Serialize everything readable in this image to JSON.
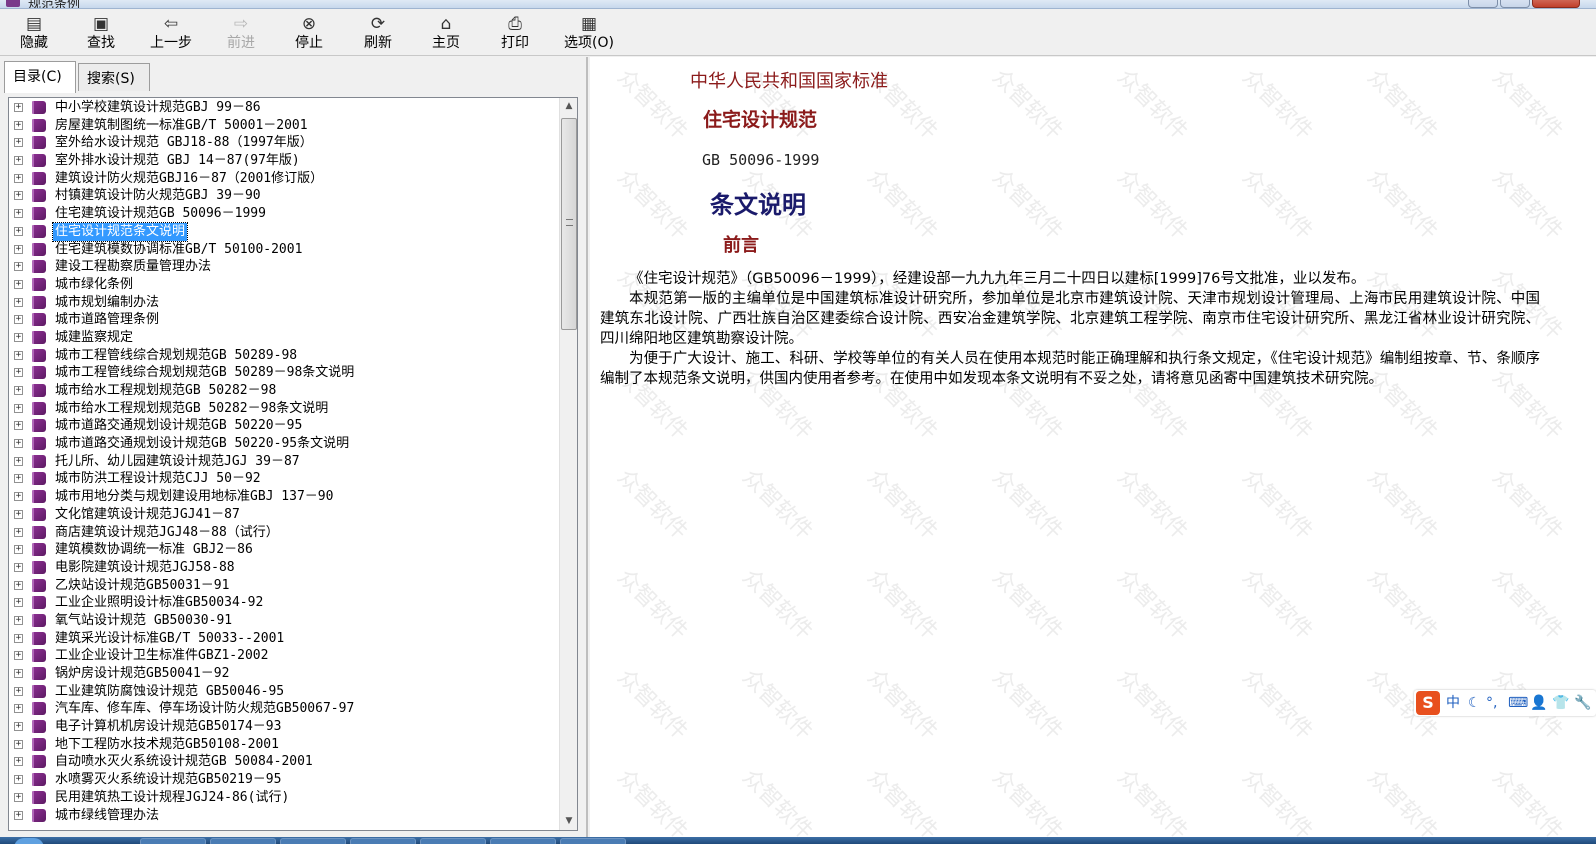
{
  "window": {
    "title": "规范条例"
  },
  "toolbar": {
    "buttons": [
      {
        "label": "隐藏",
        "icon": "hide-icon",
        "enabled": true
      },
      {
        "label": "查找",
        "icon": "find-icon",
        "enabled": true
      },
      {
        "label": "上一步",
        "icon": "back-arrow-icon",
        "enabled": true
      },
      {
        "label": "前进",
        "icon": "forward-arrow-icon",
        "enabled": false
      },
      {
        "label": "停止",
        "icon": "stop-icon",
        "enabled": true
      },
      {
        "label": "刷新",
        "icon": "refresh-icon",
        "enabled": true
      },
      {
        "label": "主页",
        "icon": "home-icon",
        "enabled": true
      },
      {
        "label": "打印",
        "icon": "print-icon",
        "enabled": true
      },
      {
        "label": "选项(O)",
        "icon": "options-icon",
        "enabled": true
      }
    ]
  },
  "sidebar": {
    "tabs": [
      {
        "label": "目录(C)",
        "active": true
      },
      {
        "label": "搜索(S)",
        "active": false
      }
    ],
    "tree": [
      {
        "label": "中小学校建筑设计规范GBJ 99－86"
      },
      {
        "label": "房屋建筑制图统一标准GB/T 50001－2001"
      },
      {
        "label": "室外给水设计规范 GBJ18-88（1997年版）"
      },
      {
        "label": "室外排水设计规范 GBJ 14－87(97年版)"
      },
      {
        "label": "建筑设计防火规范GBJ16－87（2001修订版）"
      },
      {
        "label": "村镇建筑设计防火规范GBJ 39－90"
      },
      {
        "label": "住宅建筑设计规范GB 50096－1999"
      },
      {
        "label": "住宅设计规范条文说明",
        "selected": true
      },
      {
        "label": "住宅建筑模数协调标准GB/T 50100-2001"
      },
      {
        "label": "建设工程勘察质量管理办法"
      },
      {
        "label": "城市绿化条例"
      },
      {
        "label": "城市规划编制办法"
      },
      {
        "label": "城市道路管理条例"
      },
      {
        "label": "城建监察规定"
      },
      {
        "label": "城市工程管线综合规划规范GB 50289-98"
      },
      {
        "label": "城市工程管线综合规划规范GB 50289－98条文说明"
      },
      {
        "label": "城市给水工程规划规范GB 50282－98"
      },
      {
        "label": "城市给水工程规划规范GB 50282－98条文说明"
      },
      {
        "label": "城市道路交通规划设计规范GB 50220－95"
      },
      {
        "label": "城市道路交通规划设计规范GB 50220-95条文说明"
      },
      {
        "label": "托儿所、幼儿园建筑设计规范JGJ 39－87"
      },
      {
        "label": "城市防洪工程设计规范CJJ 50－92"
      },
      {
        "label": "城市用地分类与规划建设用地标准GBJ 137－90"
      },
      {
        "label": "文化馆建筑设计规范JGJ41－87"
      },
      {
        "label": "商店建筑设计规范JGJ48－88（试行）"
      },
      {
        "label": "建筑模数协调统一标准 GBJ2－86"
      },
      {
        "label": "电影院建筑设计规范JGJ58-88"
      },
      {
        "label": "乙炔站设计规范GB50031－91"
      },
      {
        "label": "工业企业照明设计标准GB50034-92"
      },
      {
        "label": "氧气站设计规范 GB50030-91"
      },
      {
        "label": "建筑采光设计标准GB/T 50033--2001"
      },
      {
        "label": "工业企业设计卫生标准件GBZ1-2002"
      },
      {
        "label": "锅炉房设计规范GB50041－92"
      },
      {
        "label": "工业建筑防腐蚀设计规范 GB50046-95"
      },
      {
        "label": "汽车库、修车库、停车场设计防火规范GB50067-97"
      },
      {
        "label": "电子计算机机房设计规范GB50174－93"
      },
      {
        "label": "地下工程防水技术规范GB50108-2001"
      },
      {
        "label": "自动喷水灭火系统设计规范GB 50084-2001"
      },
      {
        "label": "水喷雾灭火系统设计规范GB50219－95"
      },
      {
        "label": "民用建筑热工设计规程JGJ24-86(试行)"
      },
      {
        "label": "城市绿线管理办法"
      }
    ]
  },
  "document": {
    "org": "中华人民共和国国家标准",
    "title": "住宅设计规范",
    "code": "GB 50096-1999",
    "section": "条文说明",
    "subsection": "前言",
    "paragraphs": [
      "《住宅设计规范》（GB50096－1999），经建设部一九九九年三月二十四日以建标[1999]76号文批准，业以发布。",
      "本规范第一版的主编单位是中国建筑标准设计研究所，参加单位是北京市建筑设计院、天津市规划设计管理局、上海市民用建筑设计院、中国建筑东北设计院、广西壮族自治区建委综合设计院、西安冶金建筑学院、北京建筑工程学院、南京市住宅设计研究所、黑龙江省林业设计研究院、四川绵阳地区建筑勘察设计院。",
      "为便于广大设计、施工、科研、学校等单位的有关人员在使用本规范时能正确理解和执行条文规定，《住宅设计规范》编制组按章、节、条顺序编制了本规范条文说明，供国内使用者参考。在使用中如发现本条文说明有不妥之处，请将意见函寄中国建筑技术研究院。"
    ],
    "watermark": "众智软件"
  },
  "ime": {
    "logo": "S",
    "mode": "中",
    "items": [
      "☾",
      "°,",
      "⌨",
      "👤",
      "👕",
      "🔧"
    ]
  },
  "colors": {
    "doc_red": "#8b1a1a",
    "doc_navy": "#1a1a6b",
    "selection": "#3399ff"
  }
}
